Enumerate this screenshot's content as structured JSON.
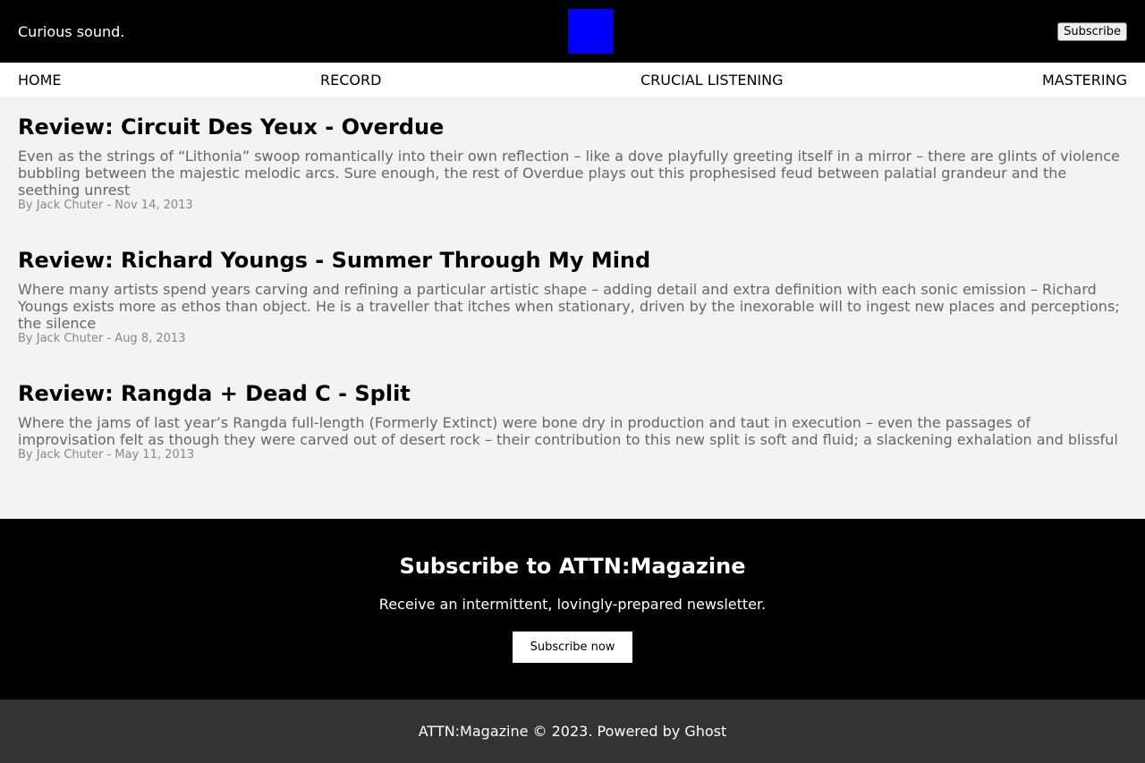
{
  "header": {
    "tagline": "Curious sound.",
    "logo_color": "#0000ff",
    "subscribe_label": "Subscribe"
  },
  "nav": {
    "items": [
      {
        "label": "HOME"
      },
      {
        "label": "RECORD"
      },
      {
        "label": "CRUCIAL LISTENING"
      },
      {
        "label": "MASTERING"
      }
    ]
  },
  "posts": [
    {
      "title": "Review: Circuit Des Yeux - Overdue",
      "excerpt": "Even as the strings of “Lithonia” swoop romantically into their own reflection – like a dove playfully greeting itself in a mirror – there are glints of violence bubbling between the majestic melodic arcs. Sure enough, the rest of Overdue plays out this prophesised feud between palatial grandeur and the seething unrest",
      "meta": "By Jack Chuter - Nov 14, 2013"
    },
    {
      "title": "Review: Richard Youngs - Summer Through My Mind",
      "excerpt": "Where many artists spend years carving and refining a particular artistic shape – adding detail and extra definition with each sonic emission – Richard Youngs exists more as ethos than object. He is a traveller that itches when stationary, driven by the inexorable will to ingest new places and perceptions; the silence",
      "meta": "By Jack Chuter - Aug 8, 2013"
    },
    {
      "title": "Review: Rangda + Dead C - Split",
      "excerpt": "Where the jams of last year’s Rangda full-length (Formerly Extinct) were bone dry in production and taut in execution – even the passages of improvisation felt as though they were carved out of desert rock – their contribution to this new split is soft and fluid; a slackening exhalation and blissful",
      "meta": "By Jack Chuter - May 11, 2013"
    }
  ],
  "newsletter": {
    "title": "Subscribe to ATTN:Magazine",
    "description": "Receive an intermittent, lovingly-prepared newsletter.",
    "button_label": "Subscribe now"
  },
  "footer": {
    "text": "ATTN:Magazine © 2023. Powered by Ghost"
  }
}
